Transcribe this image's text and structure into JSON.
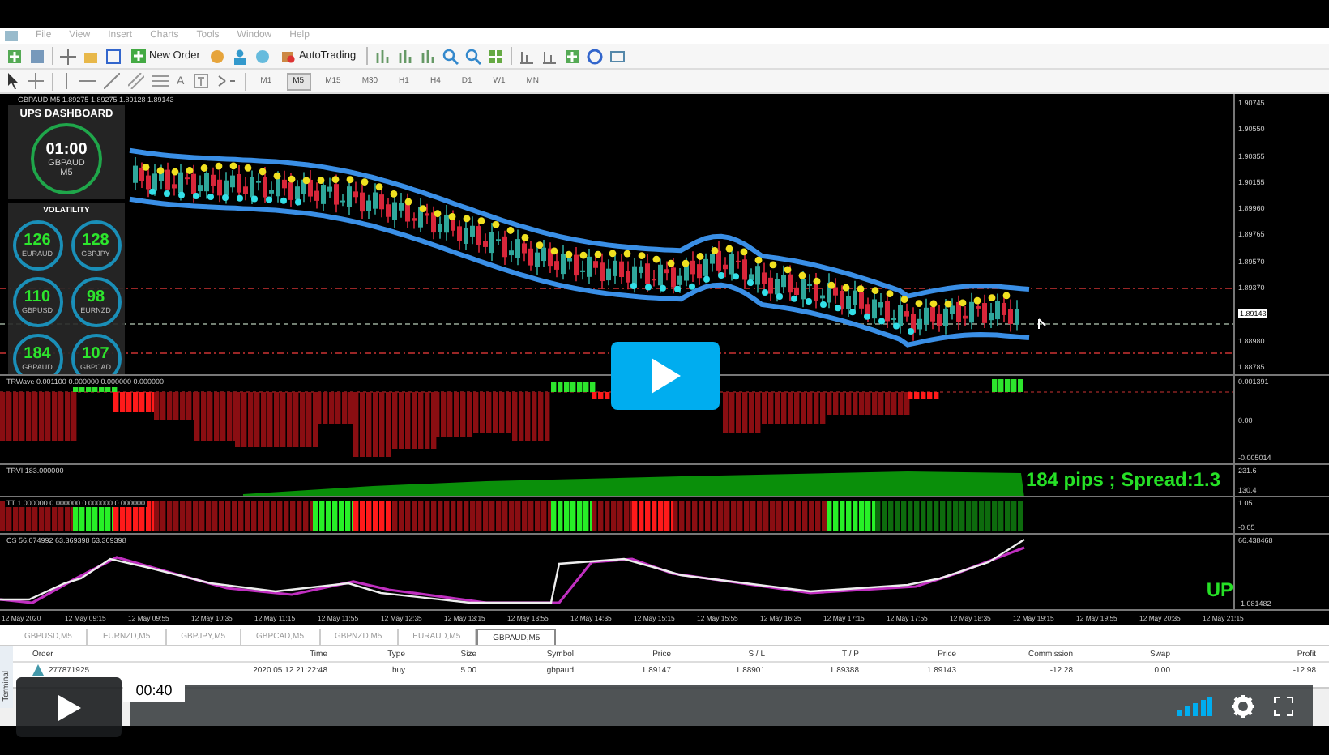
{
  "menu": [
    "File",
    "View",
    "Insert",
    "Charts",
    "Tools",
    "Window",
    "Help"
  ],
  "toolbar": {
    "new_order": "New Order",
    "auto_trading": "AutoTrading",
    "text_tool": "A"
  },
  "timeframes": [
    {
      "label": "M1",
      "selected": false
    },
    {
      "label": "M5",
      "selected": true
    },
    {
      "label": "M15",
      "selected": false
    },
    {
      "label": "M30",
      "selected": false
    },
    {
      "label": "H1",
      "selected": false
    },
    {
      "label": "H4",
      "selected": false
    },
    {
      "label": "D1",
      "selected": false
    },
    {
      "label": "W1",
      "selected": false
    },
    {
      "label": "MN",
      "selected": false
    }
  ],
  "chart": {
    "title": "GBPAUD,M5  1.89275 1.89275 1.89128 1.89143",
    "price_labels": [
      {
        "text": "1.90745",
        "current": false
      },
      {
        "text": "1.90550",
        "current": false
      },
      {
        "text": "1.90355",
        "current": false
      },
      {
        "text": "1.90155",
        "current": false
      },
      {
        "text": "1.89960",
        "current": false
      },
      {
        "text": "1.89765",
        "current": false
      },
      {
        "text": "1.89570",
        "current": false
      },
      {
        "text": "1.89370",
        "current": false
      },
      {
        "text": "1.89143",
        "current": true
      },
      {
        "text": "1.88980",
        "current": false
      },
      {
        "text": "1.88785",
        "current": false
      }
    ]
  },
  "dashboard": {
    "title": "UPS DASHBOARD",
    "timer": "01:00",
    "symbol": "GBPAUD",
    "period": "M5",
    "volatility_title": "VOLATILITY",
    "gauges": [
      {
        "value": "126",
        "pair": "EURAUD"
      },
      {
        "value": "128",
        "pair": "GBPJPY"
      },
      {
        "value": "110",
        "pair": "GBPUSD"
      },
      {
        "value": "98",
        "pair": "EURNZD"
      },
      {
        "value": "184",
        "pair": "GBPAUD"
      },
      {
        "value": "107",
        "pair": "GBPCAD"
      }
    ]
  },
  "indicators": [
    {
      "kind": "wave",
      "label": "TRWave 0.001100 0.000000 0.000000 0.000000",
      "axis": [
        "0.001391",
        "0.00",
        "-0.005014"
      ]
    },
    {
      "kind": "volume",
      "label": "TRVI 183.000000",
      "axis": [
        "231.6",
        "130.4"
      ],
      "overlay": "184 pips ; Spread:1.3"
    },
    {
      "kind": "trend",
      "label": "TT 1.000000 0.000000 0.000000 0.000000",
      "axis": [
        "1.05",
        "-0.05"
      ]
    },
    {
      "kind": "lines",
      "label": "CS 56.074992 63.369398 63.369398",
      "axis": [
        "66.438468",
        "-1.081482"
      ],
      "overlay": "UP"
    }
  ],
  "time_axis": [
    "12 May 2020",
    "12 May 09:15",
    "12 May 09:55",
    "12 May 10:35",
    "12 May 11:15",
    "12 May 11:55",
    "12 May 12:35",
    "12 May 13:15",
    "12 May 13:55",
    "12 May 14:35",
    "12 May 15:15",
    "12 May 15:55",
    "12 May 16:35",
    "12 May 17:15",
    "12 May 17:55",
    "12 May 18:35",
    "12 May 19:15",
    "12 May 19:55",
    "12 May 20:35",
    "12 May 21:15"
  ],
  "chart_tabs": [
    {
      "label": "GBPUSD,M5",
      "selected": false
    },
    {
      "label": "EURNZD,M5",
      "selected": false
    },
    {
      "label": "GBPJPY,M5",
      "selected": false
    },
    {
      "label": "GBPCAD,M5",
      "selected": false
    },
    {
      "label": "GBPNZD,M5",
      "selected": false
    },
    {
      "label": "EURAUD,M5",
      "selected": false
    },
    {
      "label": "GBPAUD,M5",
      "selected": true
    }
  ],
  "terminal": {
    "side_label": "Terminal",
    "columns": [
      "Order",
      "Time",
      "Type",
      "Size",
      "Symbol",
      "Price",
      "S / L",
      "T / P",
      "Price",
      "Commission",
      "Swap",
      "Profit"
    ],
    "rows": [
      [
        "277871925",
        "2020.05.12 21:22:48",
        "buy",
        "5.00",
        "gbpaud",
        "1.89147",
        "1.88901",
        "1.89388",
        "1.89143",
        "-12.28",
        "0.00",
        "-12.98"
      ]
    ]
  },
  "video": {
    "time": "00:40"
  }
}
